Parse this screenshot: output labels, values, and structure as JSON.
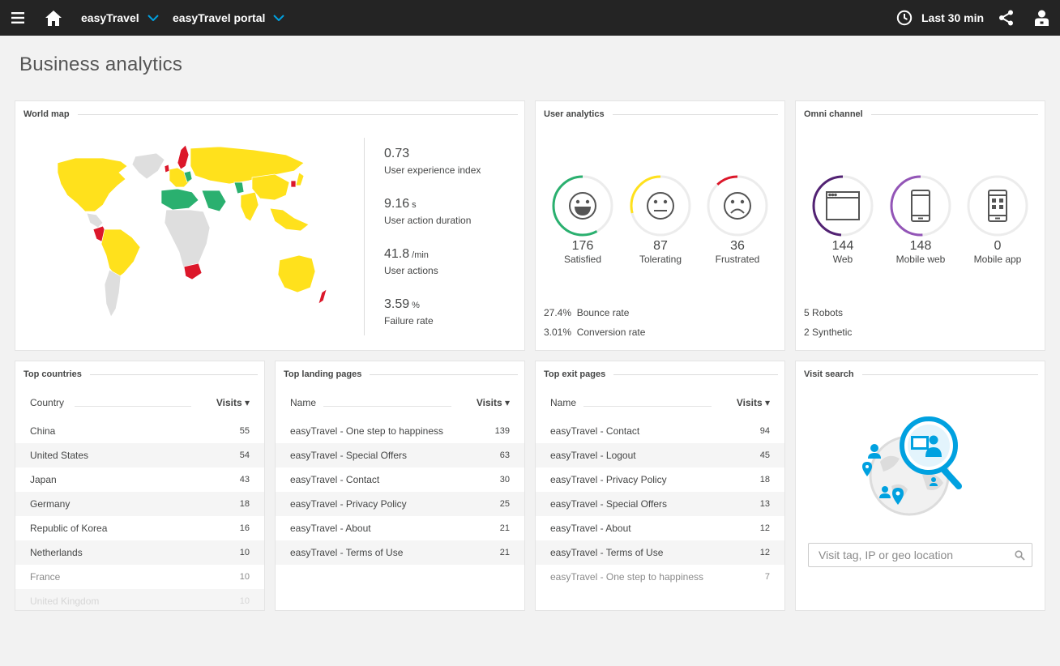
{
  "topbar": {
    "app": "easyTravel",
    "application": "easyTravel portal",
    "timeframe": "Last 30 min",
    "icons": [
      "menu-icon",
      "home-icon",
      "chevron-down-icon",
      "clock-icon",
      "share-icon",
      "user-icon"
    ]
  },
  "page": {
    "title": "Business analytics"
  },
  "world_map": {
    "title": "World map",
    "kpis": [
      {
        "value": "0.73",
        "unit": "",
        "label": "User experience index"
      },
      {
        "value": "9.16",
        "unit": "s",
        "label": "User action duration"
      },
      {
        "value": "41.8",
        "unit": "/min",
        "label": "User actions"
      },
      {
        "value": "3.59",
        "unit": "%",
        "label": "Failure rate"
      }
    ],
    "colors": {
      "satisfied": "#ffe11c",
      "tolerating": "#2ab06f",
      "frustrated": "#dc172a",
      "no_data": "#dedede"
    }
  },
  "user_analytics": {
    "title": "User analytics",
    "gauges": [
      {
        "value": "176",
        "label": "Satisfied",
        "fraction": 0.58,
        "color": "#2ab06f"
      },
      {
        "value": "87",
        "label": "Tolerating",
        "fraction": 0.29,
        "color": "#ffe11c"
      },
      {
        "value": "36",
        "label": "Frustrated",
        "fraction": 0.12,
        "color": "#dc172a"
      }
    ],
    "bounce": {
      "value": "27.4%",
      "label": "Bounce rate"
    },
    "conversion": {
      "value": "3.01%",
      "label": "Conversion rate"
    }
  },
  "omni": {
    "title": "Omni channel",
    "gauges": [
      {
        "value": "144",
        "label": "Web",
        "fraction": 0.49,
        "color": "#522273"
      },
      {
        "value": "148",
        "label": "Mobile web",
        "fraction": 0.51,
        "color": "#9355b7"
      },
      {
        "value": "0",
        "label": "Mobile app",
        "fraction": 0,
        "color": "#9355b7"
      }
    ],
    "robots": {
      "value": "5",
      "label": "Robots"
    },
    "synthetic": {
      "value": "2",
      "label": "Synthetic"
    }
  },
  "top_countries": {
    "title": "Top countries",
    "col_name": "Country",
    "col_visits": "Visits ▾",
    "rows": [
      {
        "name": "China",
        "visits": "55"
      },
      {
        "name": "United States",
        "visits": "54"
      },
      {
        "name": "Japan",
        "visits": "43"
      },
      {
        "name": "Germany",
        "visits": "18"
      },
      {
        "name": "Republic of Korea",
        "visits": "16"
      },
      {
        "name": "Netherlands",
        "visits": "10"
      },
      {
        "name": "France",
        "visits": "10"
      },
      {
        "name": "United Kingdom",
        "visits": "10"
      }
    ]
  },
  "top_landing": {
    "title": "Top landing pages",
    "col_name": "Name",
    "col_visits": "Visits ▾",
    "rows": [
      {
        "name": "easyTravel - One step to happiness",
        "visits": "139"
      },
      {
        "name": "easyTravel - Special Offers",
        "visits": "63"
      },
      {
        "name": "easyTravel - Contact",
        "visits": "30"
      },
      {
        "name": "easyTravel - Privacy Policy",
        "visits": "25"
      },
      {
        "name": "easyTravel - About",
        "visits": "21"
      },
      {
        "name": "easyTravel - Terms of Use",
        "visits": "21"
      }
    ]
  },
  "top_exit": {
    "title": "Top exit pages",
    "col_name": "Name",
    "col_visits": "Visits ▾",
    "rows": [
      {
        "name": "easyTravel - Contact",
        "visits": "94"
      },
      {
        "name": "easyTravel - Logout",
        "visits": "45"
      },
      {
        "name": "easyTravel - Privacy Policy",
        "visits": "18"
      },
      {
        "name": "easyTravel - Special Offers",
        "visits": "13"
      },
      {
        "name": "easyTravel - About",
        "visits": "12"
      },
      {
        "name": "easyTravel - Terms of Use",
        "visits": "12"
      },
      {
        "name": "easyTravel - One step to happiness",
        "visits": "7"
      }
    ]
  },
  "visit_search": {
    "title": "Visit search",
    "placeholder": "Visit tag, IP or geo location",
    "accent": "#00a1e0"
  }
}
